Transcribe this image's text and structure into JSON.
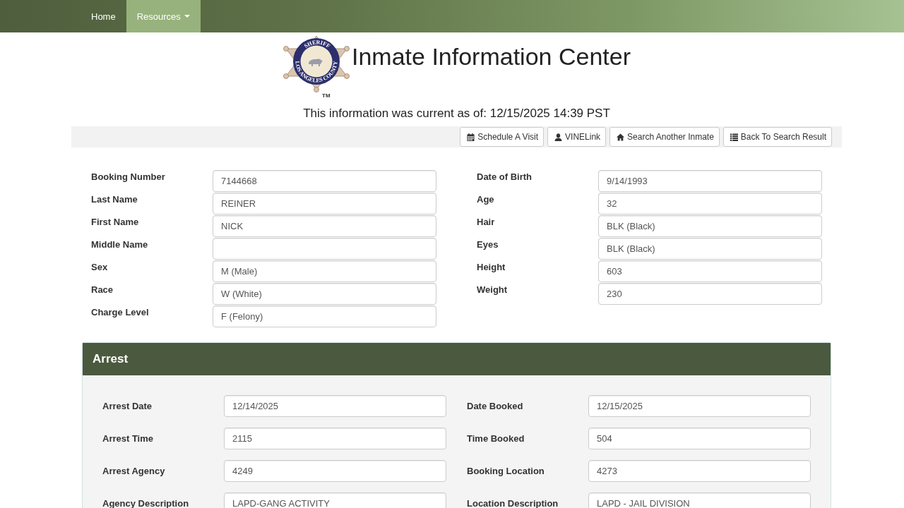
{
  "nav": {
    "items": [
      {
        "label": "Home",
        "selected": false,
        "dropdown": false
      },
      {
        "label": "Resources",
        "selected": true,
        "dropdown": true
      }
    ]
  },
  "header": {
    "logo": {
      "top_text": "SHERIFF",
      "bottom_text": "LOS ANGELES COUNTY",
      "trademark": "TM"
    },
    "title": "Inmate Information Center",
    "as_of": "This information was current as of: 12/15/2025 14:39 PST"
  },
  "toolbar": {
    "buttons": [
      "Schedule A Visit",
      "VINELink",
      "Search Another Inmate",
      "Back To Search Result"
    ]
  },
  "inmate": {
    "left": [
      {
        "label": "Booking Number",
        "value": "7144668"
      },
      {
        "label": "Last Name",
        "value": "REINER"
      },
      {
        "label": "First Name",
        "value": "NICK"
      },
      {
        "label": "Middle Name"
      },
      {
        "label": "Sex",
        "value": "M (Male)"
      },
      {
        "label": "Race",
        "value": "W (White)"
      },
      {
        "label": "Charge Level",
        "value": "F (Felony)"
      }
    ],
    "right": [
      {
        "label": "Date of Birth",
        "value": "9/14/1993"
      },
      {
        "label": "Age",
        "value": "32"
      },
      {
        "label": "Hair",
        "value": "BLK (Black)"
      },
      {
        "label": "Eyes",
        "value": "BLK (Black)"
      },
      {
        "label": "Height",
        "value": "603"
      },
      {
        "label": "Weight",
        "value": "230"
      }
    ]
  },
  "arrest": {
    "title": "Arrest",
    "left": [
      {
        "label": "Arrest Date",
        "value": "12/14/2025"
      },
      {
        "label": "Arrest Time",
        "value": "2115"
      },
      {
        "label": "Arrest Agency",
        "value": "4249"
      },
      {
        "label": "Agency Description",
        "value": "LAPD-GANG ACTIVITY"
      }
    ],
    "right": [
      {
        "label": "Date Booked",
        "value": "12/15/2025"
      },
      {
        "label": "Time Booked",
        "value": "504"
      },
      {
        "label": "Booking Location",
        "value": "4273"
      },
      {
        "label": "Location Description",
        "value": "LAPD - JAIL DIVISION"
      }
    ]
  }
}
